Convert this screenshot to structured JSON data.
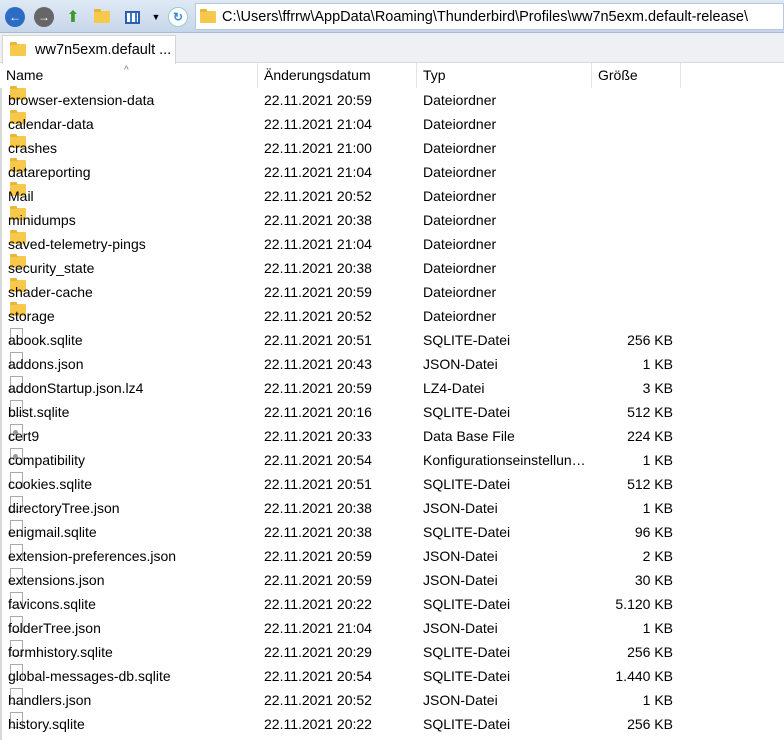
{
  "toolbar": {
    "address": "C:\\Users\\ffrrw\\AppData\\Roaming\\Thunderbird\\Profiles\\ww7n5exm.default-release\\",
    "buttons": [
      "back-icon",
      "forward-icon",
      "up-folder-icon",
      "new-folder-icon",
      "view-icon",
      "dropdown-icon",
      "refresh-icon"
    ]
  },
  "tab": {
    "label": "ww7n5exm.default ..."
  },
  "columns": {
    "name": "Name",
    "date": "Änderungsdatum",
    "type": "Typ",
    "size": "Größe"
  },
  "files": [
    {
      "name": "browser-extension-data",
      "date": "22.11.2021 20:59",
      "type": "Dateiordner",
      "size": "",
      "icon": "folder"
    },
    {
      "name": "calendar-data",
      "date": "22.11.2021 21:04",
      "type": "Dateiordner",
      "size": "",
      "icon": "folder"
    },
    {
      "name": "crashes",
      "date": "22.11.2021 21:00",
      "type": "Dateiordner",
      "size": "",
      "icon": "folder"
    },
    {
      "name": "datareporting",
      "date": "22.11.2021 21:04",
      "type": "Dateiordner",
      "size": "",
      "icon": "folder"
    },
    {
      "name": "Mail",
      "date": "22.11.2021 20:52",
      "type": "Dateiordner",
      "size": "",
      "icon": "folder"
    },
    {
      "name": "minidumps",
      "date": "22.11.2021 20:38",
      "type": "Dateiordner",
      "size": "",
      "icon": "folder"
    },
    {
      "name": "saved-telemetry-pings",
      "date": "22.11.2021 21:04",
      "type": "Dateiordner",
      "size": "",
      "icon": "folder"
    },
    {
      "name": "security_state",
      "date": "22.11.2021 20:38",
      "type": "Dateiordner",
      "size": "",
      "icon": "folder"
    },
    {
      "name": "shader-cache",
      "date": "22.11.2021 20:59",
      "type": "Dateiordner",
      "size": "",
      "icon": "folder"
    },
    {
      "name": "storage",
      "date": "22.11.2021 20:52",
      "type": "Dateiordner",
      "size": "",
      "icon": "folder"
    },
    {
      "name": "abook.sqlite",
      "date": "22.11.2021 20:51",
      "type": "SQLITE-Datei",
      "size": "256 KB",
      "icon": "file"
    },
    {
      "name": "addons.json",
      "date": "22.11.2021 20:43",
      "type": "JSON-Datei",
      "size": "1 KB",
      "icon": "file"
    },
    {
      "name": "addonStartup.json.lz4",
      "date": "22.11.2021 20:59",
      "type": "LZ4-Datei",
      "size": "3 KB",
      "icon": "file"
    },
    {
      "name": "blist.sqlite",
      "date": "22.11.2021 20:16",
      "type": "SQLITE-Datei",
      "size": "512 KB",
      "icon": "file"
    },
    {
      "name": "cert9",
      "date": "22.11.2021 20:33",
      "type": "Data Base File",
      "size": "224 KB",
      "icon": "cfg"
    },
    {
      "name": "compatibility",
      "date": "22.11.2021 20:54",
      "type": "Konfigurationseinstellungen",
      "size": "1 KB",
      "icon": "cfg"
    },
    {
      "name": "cookies.sqlite",
      "date": "22.11.2021 20:51",
      "type": "SQLITE-Datei",
      "size": "512 KB",
      "icon": "file"
    },
    {
      "name": "directoryTree.json",
      "date": "22.11.2021 20:38",
      "type": "JSON-Datei",
      "size": "1 KB",
      "icon": "file"
    },
    {
      "name": "enigmail.sqlite",
      "date": "22.11.2021 20:38",
      "type": "SQLITE-Datei",
      "size": "96 KB",
      "icon": "file"
    },
    {
      "name": "extension-preferences.json",
      "date": "22.11.2021 20:59",
      "type": "JSON-Datei",
      "size": "2 KB",
      "icon": "file"
    },
    {
      "name": "extensions.json",
      "date": "22.11.2021 20:59",
      "type": "JSON-Datei",
      "size": "30 KB",
      "icon": "file"
    },
    {
      "name": "favicons.sqlite",
      "date": "22.11.2021 20:22",
      "type": "SQLITE-Datei",
      "size": "5.120 KB",
      "icon": "file"
    },
    {
      "name": "folderTree.json",
      "date": "22.11.2021 21:04",
      "type": "JSON-Datei",
      "size": "1 KB",
      "icon": "file"
    },
    {
      "name": "formhistory.sqlite",
      "date": "22.11.2021 20:29",
      "type": "SQLITE-Datei",
      "size": "256 KB",
      "icon": "file"
    },
    {
      "name": "global-messages-db.sqlite",
      "date": "22.11.2021 20:54",
      "type": "SQLITE-Datei",
      "size": "1.440 KB",
      "icon": "file"
    },
    {
      "name": "handlers.json",
      "date": "22.11.2021 20:52",
      "type": "JSON-Datei",
      "size": "1 KB",
      "icon": "file"
    },
    {
      "name": "history.sqlite",
      "date": "22.11.2021 20:22",
      "type": "SQLITE-Datei",
      "size": "256 KB",
      "icon": "file"
    }
  ]
}
